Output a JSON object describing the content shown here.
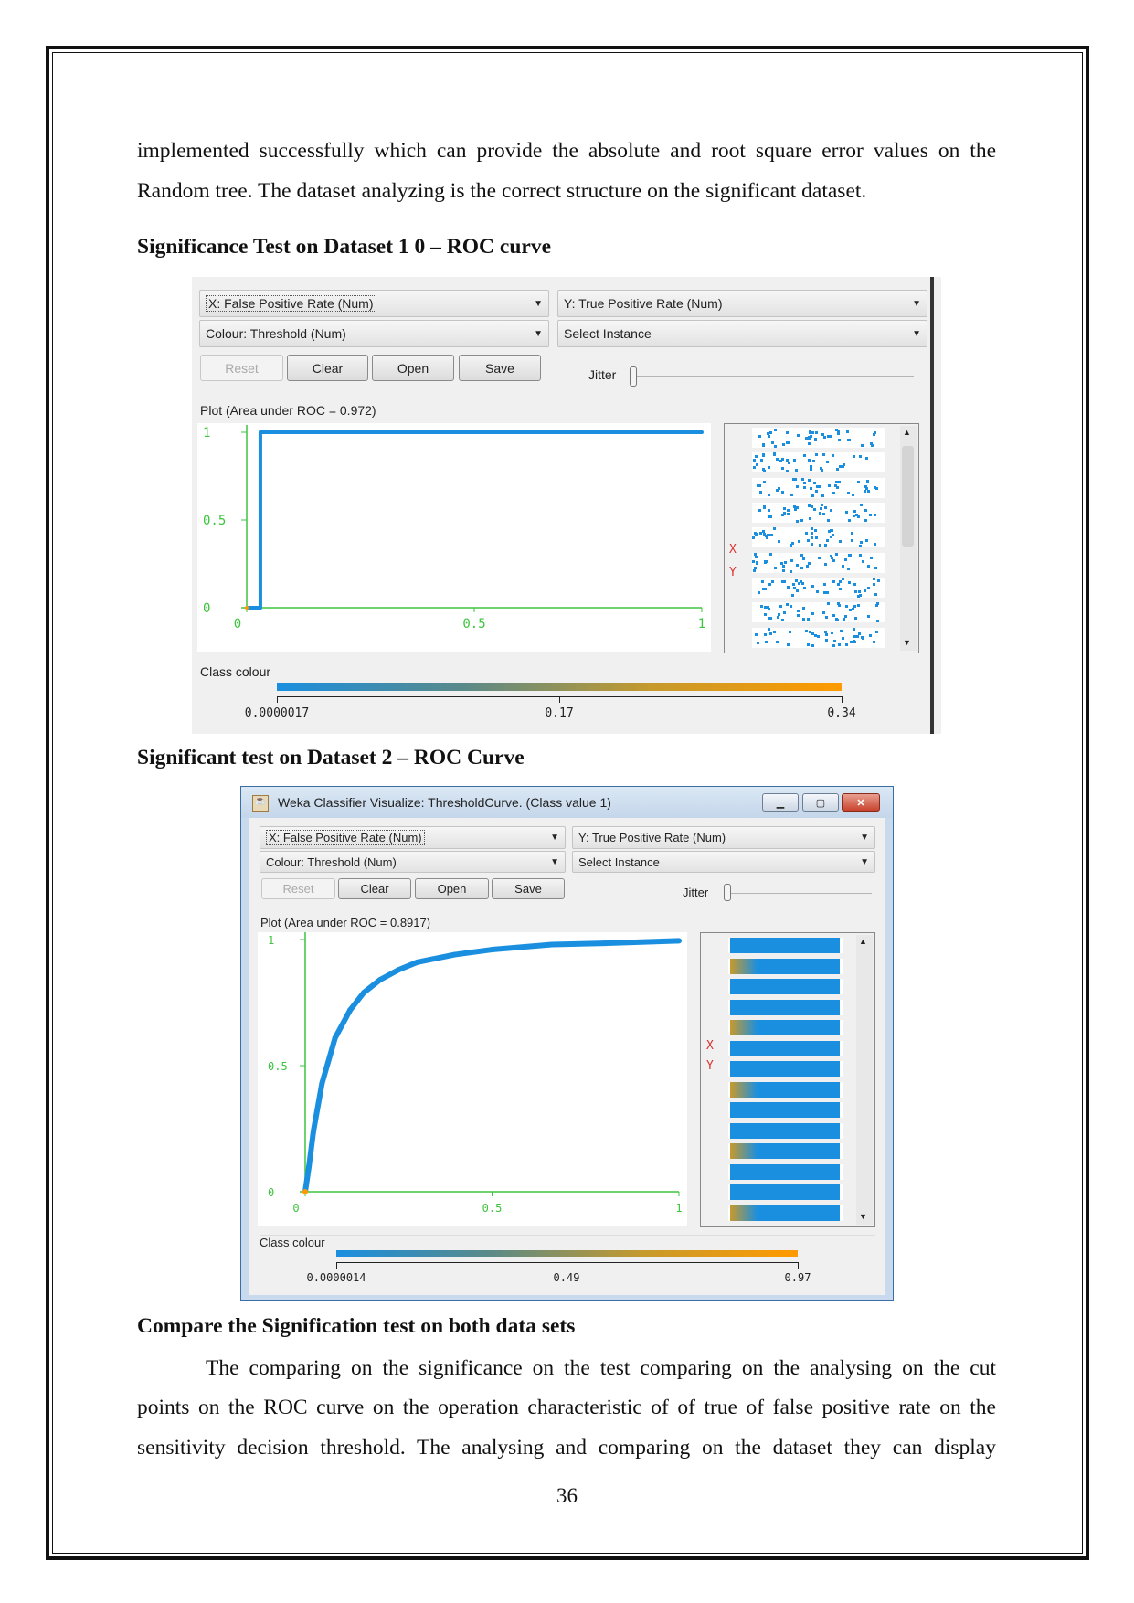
{
  "body": {
    "para1_line1": "implemented successfully which can provide the absolute and root square error values on the",
    "para1_line2": "Random tree. The dataset analyzing is the correct structure on the significant dataset.",
    "heading1": "Significance Test on Dataset 1 0 – ROC curve",
    "heading2": "Significant test on Dataset 2 – ROC Curve",
    "heading3": "Compare the Signification test on both data sets",
    "para2_line1": "The comparing on the significance on the test comparing on the analysing on the cut",
    "para2_line2": "points on the ROC curve on the  operation characteristic of of true of false positive rate on the",
    "para2_line3": "sensitivity decision threshold. The analysing and comparing on the dataset they can display",
    "page_number": "36"
  },
  "weka1": {
    "x_select": "X: False Positive Rate (Num)",
    "y_select": "Y: True Positive Rate (Num)",
    "colour_select": "Colour: Threshold (Num)",
    "instance_select": "Select Instance",
    "reset": "Reset",
    "clear": "Clear",
    "open": "Open",
    "save": "Save",
    "jitter": "Jitter",
    "plot_title": "Plot (Area under ROC = 0.972)",
    "x_letter": "X",
    "y_letter": "Y",
    "class_colour": "Class colour",
    "colour_ticks": [
      "0.0000017",
      "0.17",
      "0.34"
    ]
  },
  "weka2": {
    "window_title": "Weka Classifier Visualize: ThresholdCurve. (Class value 1)",
    "x_select": "X: False Positive Rate (Num)",
    "y_select": "Y: True Positive Rate (Num)",
    "colour_select": "Colour: Threshold (Num)",
    "instance_select": "Select Instance",
    "reset": "Reset",
    "clear": "Clear",
    "open": "Open",
    "save": "Save",
    "jitter": "Jitter",
    "plot_title": "Plot (Area under ROC = 0.8917)",
    "x_letter": "X",
    "y_letter": "Y",
    "class_colour": "Class colour",
    "colour_ticks": [
      "0.0000014",
      "0.49",
      "0.97"
    ]
  },
  "colors": {
    "curve": "#1a8fe0",
    "axis": "#3ec43e",
    "low": "#1a8fe0",
    "high": "#ff9a00"
  },
  "chart_data": [
    {
      "type": "line",
      "title": "Plot (Area under ROC = 0.972)",
      "xlabel": "False Positive Rate",
      "ylabel": "True Positive Rate",
      "xlim": [
        0,
        1
      ],
      "ylim": [
        0,
        1
      ],
      "xticks": [
        "0",
        "0.5",
        "1"
      ],
      "yticks": [
        "0",
        "0.5",
        "1"
      ],
      "x": [
        0,
        0.03,
        0.03,
        0.03,
        0.2,
        0.5,
        0.8,
        1
      ],
      "y": [
        0,
        0,
        0.5,
        1,
        1,
        1,
        1,
        1
      ]
    },
    {
      "type": "line",
      "title": "Plot (Area under ROC = 0.8917)",
      "xlabel": "False Positive Rate",
      "ylabel": "True Positive Rate",
      "xlim": [
        0,
        1
      ],
      "ylim": [
        0,
        1
      ],
      "xticks": [
        "0",
        "0.5",
        "1"
      ],
      "yticks": [
        "0",
        "0.5",
        "1"
      ],
      "x": [
        0,
        0.01,
        0.022,
        0.045,
        0.08,
        0.12,
        0.157,
        0.2,
        0.25,
        0.3,
        0.4,
        0.5,
        0.66,
        0.8,
        1
      ],
      "y": [
        0,
        0.1,
        0.24,
        0.43,
        0.61,
        0.72,
        0.79,
        0.84,
        0.88,
        0.91,
        0.94,
        0.96,
        0.98,
        0.985,
        0.995
      ]
    }
  ]
}
